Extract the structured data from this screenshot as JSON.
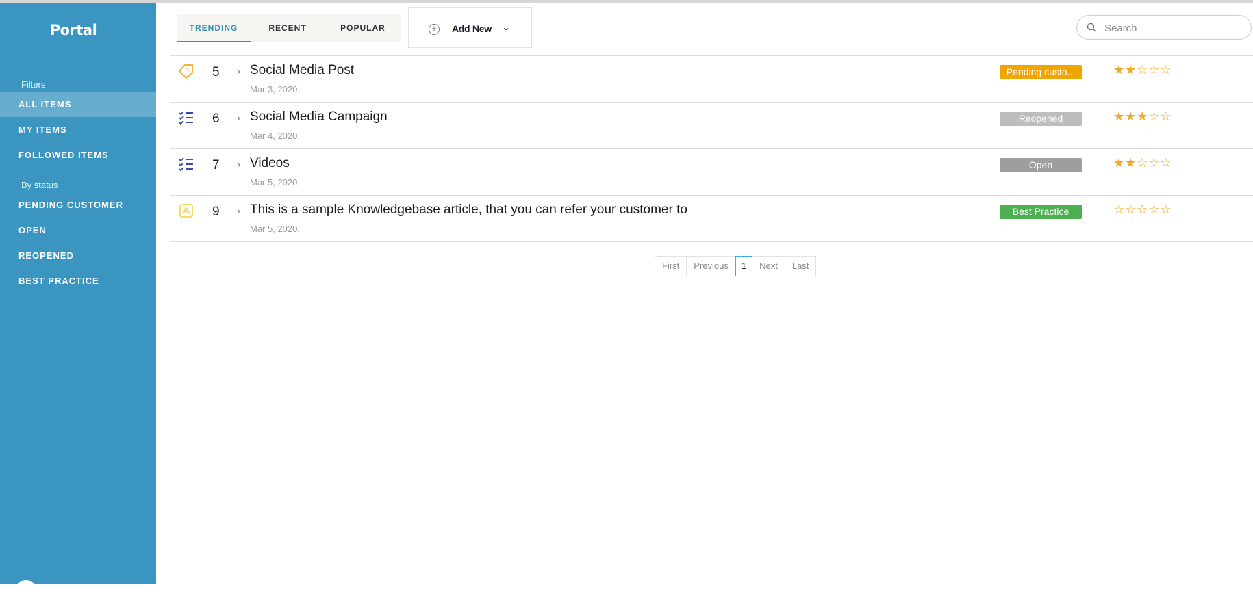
{
  "sidebar": {
    "brand": "Portal",
    "filters_label": "Filters",
    "filter_items": [
      {
        "label": "ALL ITEMS",
        "active": true
      },
      {
        "label": "MY ITEMS",
        "active": false
      },
      {
        "label": "FOLLOWED ITEMS",
        "active": false
      }
    ],
    "status_label": "By status",
    "status_items": [
      {
        "label": "PENDING CUSTOMER"
      },
      {
        "label": "OPEN"
      },
      {
        "label": "REOPENED"
      },
      {
        "label": "BEST PRACTICE"
      }
    ]
  },
  "header": {
    "tabs": [
      {
        "label": "TRENDING",
        "active": true
      },
      {
        "label": "RECENT",
        "active": false
      },
      {
        "label": "POPULAR",
        "active": false
      }
    ],
    "add_new_label": "Add New",
    "search_placeholder": "Search"
  },
  "items": [
    {
      "icon": "ticket-icon",
      "number": "5",
      "title": "Social Media Post",
      "date": "Mar 3, 2020.",
      "status": "Pending custo...",
      "status_color": "#f0a500",
      "rating": 2,
      "rating_max": 5
    },
    {
      "icon": "checklist-icon",
      "number": "6",
      "title": "Social Media Campaign",
      "date": "Mar 4, 2020.",
      "status": "Reopened",
      "status_color": "#bdbdbd",
      "rating": 3,
      "rating_max": 5
    },
    {
      "icon": "checklist-icon",
      "number": "7",
      "title": "Videos",
      "date": "Mar 5, 2020.",
      "status": "Open",
      "status_color": "#9e9e9e",
      "rating": 2,
      "rating_max": 5
    },
    {
      "icon": "article-icon",
      "number": "9",
      "title": "This is a sample Knowledgebase article, that you can refer your customer to",
      "date": "Mar 5, 2020.",
      "status": "Best Practice",
      "status_color": "#4caf50",
      "rating": 0,
      "rating_max": 5
    }
  ],
  "pagination": {
    "first": "First",
    "previous": "Previous",
    "current": "1",
    "next": "Next",
    "last": "Last"
  },
  "colors": {
    "sidebar_bg": "#3a96c1",
    "accent": "#3a8fb7",
    "star": "#f0a826"
  }
}
